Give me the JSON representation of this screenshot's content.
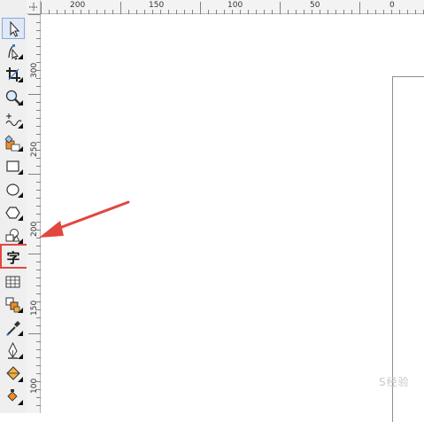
{
  "top_ruler_labels": [
    "200",
    "150",
    "100",
    "50",
    "0"
  ],
  "left_ruler_labels": [
    "300",
    "250",
    "200",
    "150",
    "100"
  ],
  "text_tool_glyph": "字",
  "watermark_text": "S经验",
  "colors": {
    "highlight": "#e2473f",
    "arrow": "#e2473f",
    "toolbox": "#efefef",
    "ruler": "#f3f3f3"
  },
  "tools": [
    {
      "name": "pick-tool",
      "icon": "arrow-cursor-icon",
      "selected": true
    },
    {
      "name": "shape-tool",
      "icon": "node-edit-icon"
    },
    {
      "name": "crop-tool",
      "icon": "crop-icon"
    },
    {
      "name": "zoom-tool",
      "icon": "magnifier-icon"
    },
    {
      "name": "freehand-tool",
      "icon": "freehand-curve-icon"
    },
    {
      "name": "smart-fill-tool",
      "icon": "smart-fill-icon"
    },
    {
      "name": "rectangle-tool",
      "icon": "rectangle-icon"
    },
    {
      "name": "ellipse-tool",
      "icon": "ellipse-icon"
    },
    {
      "name": "polygon-tool",
      "icon": "hexagon-icon"
    },
    {
      "name": "basic-shapes-tool",
      "icon": "basic-shapes-icon"
    },
    {
      "name": "text-tool",
      "icon": "text-tool-icon"
    },
    {
      "name": "table-tool",
      "icon": "table-icon"
    },
    {
      "name": "parallel-dimension-tool",
      "icon": "dimension-icon"
    },
    {
      "name": "eyedropper-tool",
      "icon": "eyedropper-icon"
    },
    {
      "name": "outline-pen-tool",
      "icon": "pen-nib-icon"
    },
    {
      "name": "fill-tool",
      "icon": "paint-bucket-icon"
    },
    {
      "name": "interactive-fill-tool",
      "icon": "interactive-fill-icon"
    }
  ]
}
